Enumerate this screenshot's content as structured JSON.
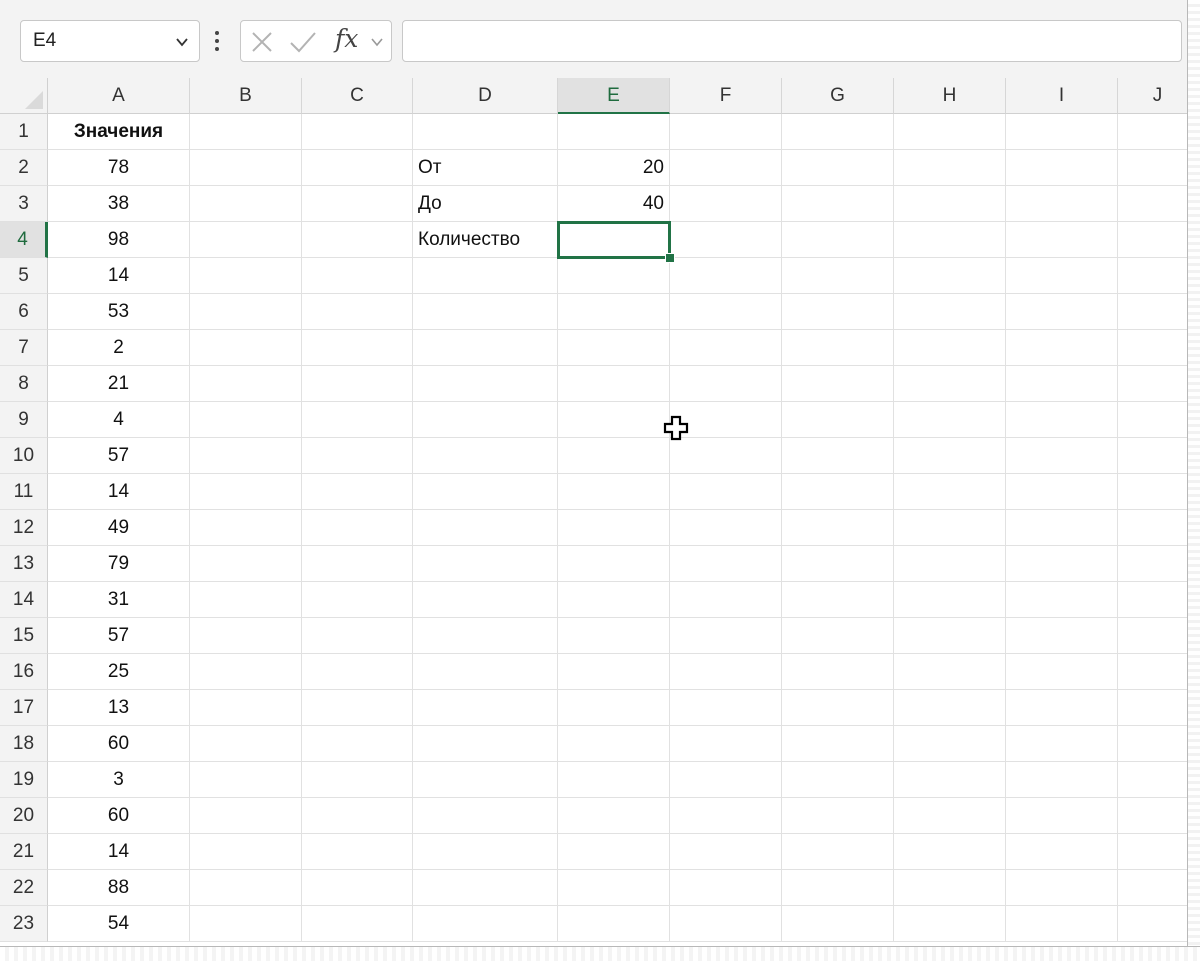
{
  "formula_bar": {
    "name_box": "E4",
    "fx_label": "fx",
    "formula": ""
  },
  "columns": [
    "A",
    "B",
    "C",
    "D",
    "E",
    "F",
    "G",
    "H",
    "I",
    "J"
  ],
  "active_column": "E",
  "active_row": 4,
  "rows": [
    1,
    2,
    3,
    4,
    5,
    6,
    7,
    8,
    9,
    10,
    11,
    12,
    13,
    14,
    15,
    16,
    17,
    18,
    19,
    20,
    21,
    22,
    23
  ],
  "column_a": {
    "header": "Значения",
    "values": [
      "78",
      "38",
      "98",
      "14",
      "53",
      "2",
      "21",
      "4",
      "57",
      "14",
      "49",
      "79",
      "31",
      "57",
      "25",
      "13",
      "60",
      "3",
      "60",
      "14",
      "88",
      "54"
    ]
  },
  "criteria": {
    "from_label": "От",
    "from_value": "20",
    "to_label": "До",
    "to_value": "40",
    "count_label": "Количество",
    "count_value": ""
  },
  "colors": {
    "accent": "#217346",
    "header_bg": "#f3f3f3",
    "gridline": "#e1e1e1"
  }
}
